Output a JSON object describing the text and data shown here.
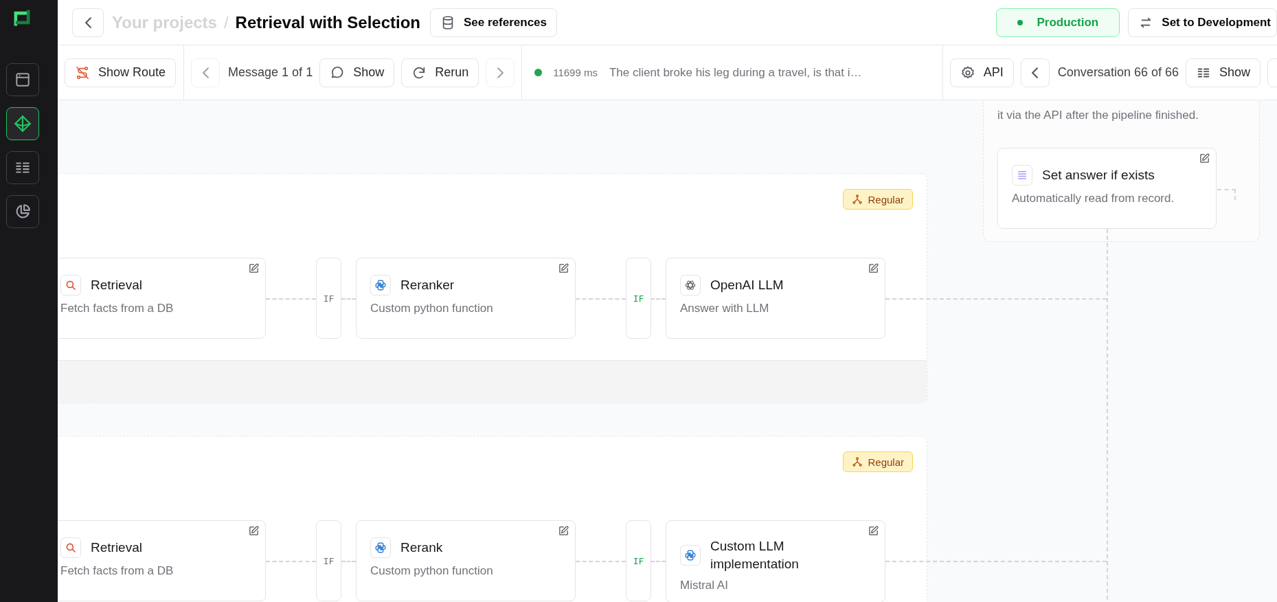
{
  "sidebar": {
    "items": [
      {
        "kind": "window",
        "selected": false
      },
      {
        "kind": "pipeline",
        "selected": true
      },
      {
        "kind": "list",
        "selected": false
      },
      {
        "kind": "chart",
        "selected": false
      }
    ]
  },
  "header": {
    "breadcrumb": [
      {
        "label": "Your projects",
        "current": false
      },
      {
        "label": "Retrieval with Selection",
        "current": true
      }
    ],
    "separator": "/",
    "references_button": "See references",
    "environment": {
      "label": "Production",
      "selected": true
    },
    "switch_button": "Set to Development"
  },
  "toolbar": {
    "route_button": "Show Route",
    "message_prev": {
      "disabled": true
    },
    "message_counter": "Message 1 of 1",
    "message_show_button": "Show",
    "rerun_button": "Rerun",
    "message_next": {
      "disabled": true
    },
    "succeeded": true,
    "duration": "11699 ms",
    "message": "The client broke his leg during a travel, is that i…",
    "api_button": "API",
    "conversation_prev": {
      "disabled": false
    },
    "conversation_counter": "Conversation 66 of 66",
    "conversation_show_button": "Show"
  },
  "canvas": {
    "groups": [
      {
        "badge": "Regular",
        "nodes": [
          {
            "kind": "retrieval",
            "title": "Retrieval",
            "description": "Fetch facts from a DB"
          },
          {
            "kind": "python",
            "title": "Reranker",
            "description": "Custom python function"
          },
          {
            "kind": "openai",
            "title": "OpenAI LLM",
            "description": "Answer with LLM"
          }
        ],
        "conditions": [
          {
            "label": "IF",
            "matched": false
          },
          {
            "label": "IF",
            "matched": true
          }
        ]
      },
      {
        "badge": "Regular",
        "nodes": [
          {
            "kind": "retrieval",
            "title": "Retrieval",
            "description": "Fetch facts from a DB"
          },
          {
            "kind": "python",
            "title": "Rerank",
            "description": "Custom python function"
          },
          {
            "kind": "python",
            "title": "Custom LLM implementation",
            "description": "Mistral AI"
          }
        ],
        "conditions": [
          {
            "label": "IF",
            "matched": false
          },
          {
            "label": "IF",
            "matched": true
          }
        ]
      }
    ],
    "output_panel": {
      "description": "it via the API after the pipeline finished.",
      "node": {
        "kind": "list",
        "title": "Set answer if exists",
        "description": "Automatically read from record."
      }
    }
  }
}
